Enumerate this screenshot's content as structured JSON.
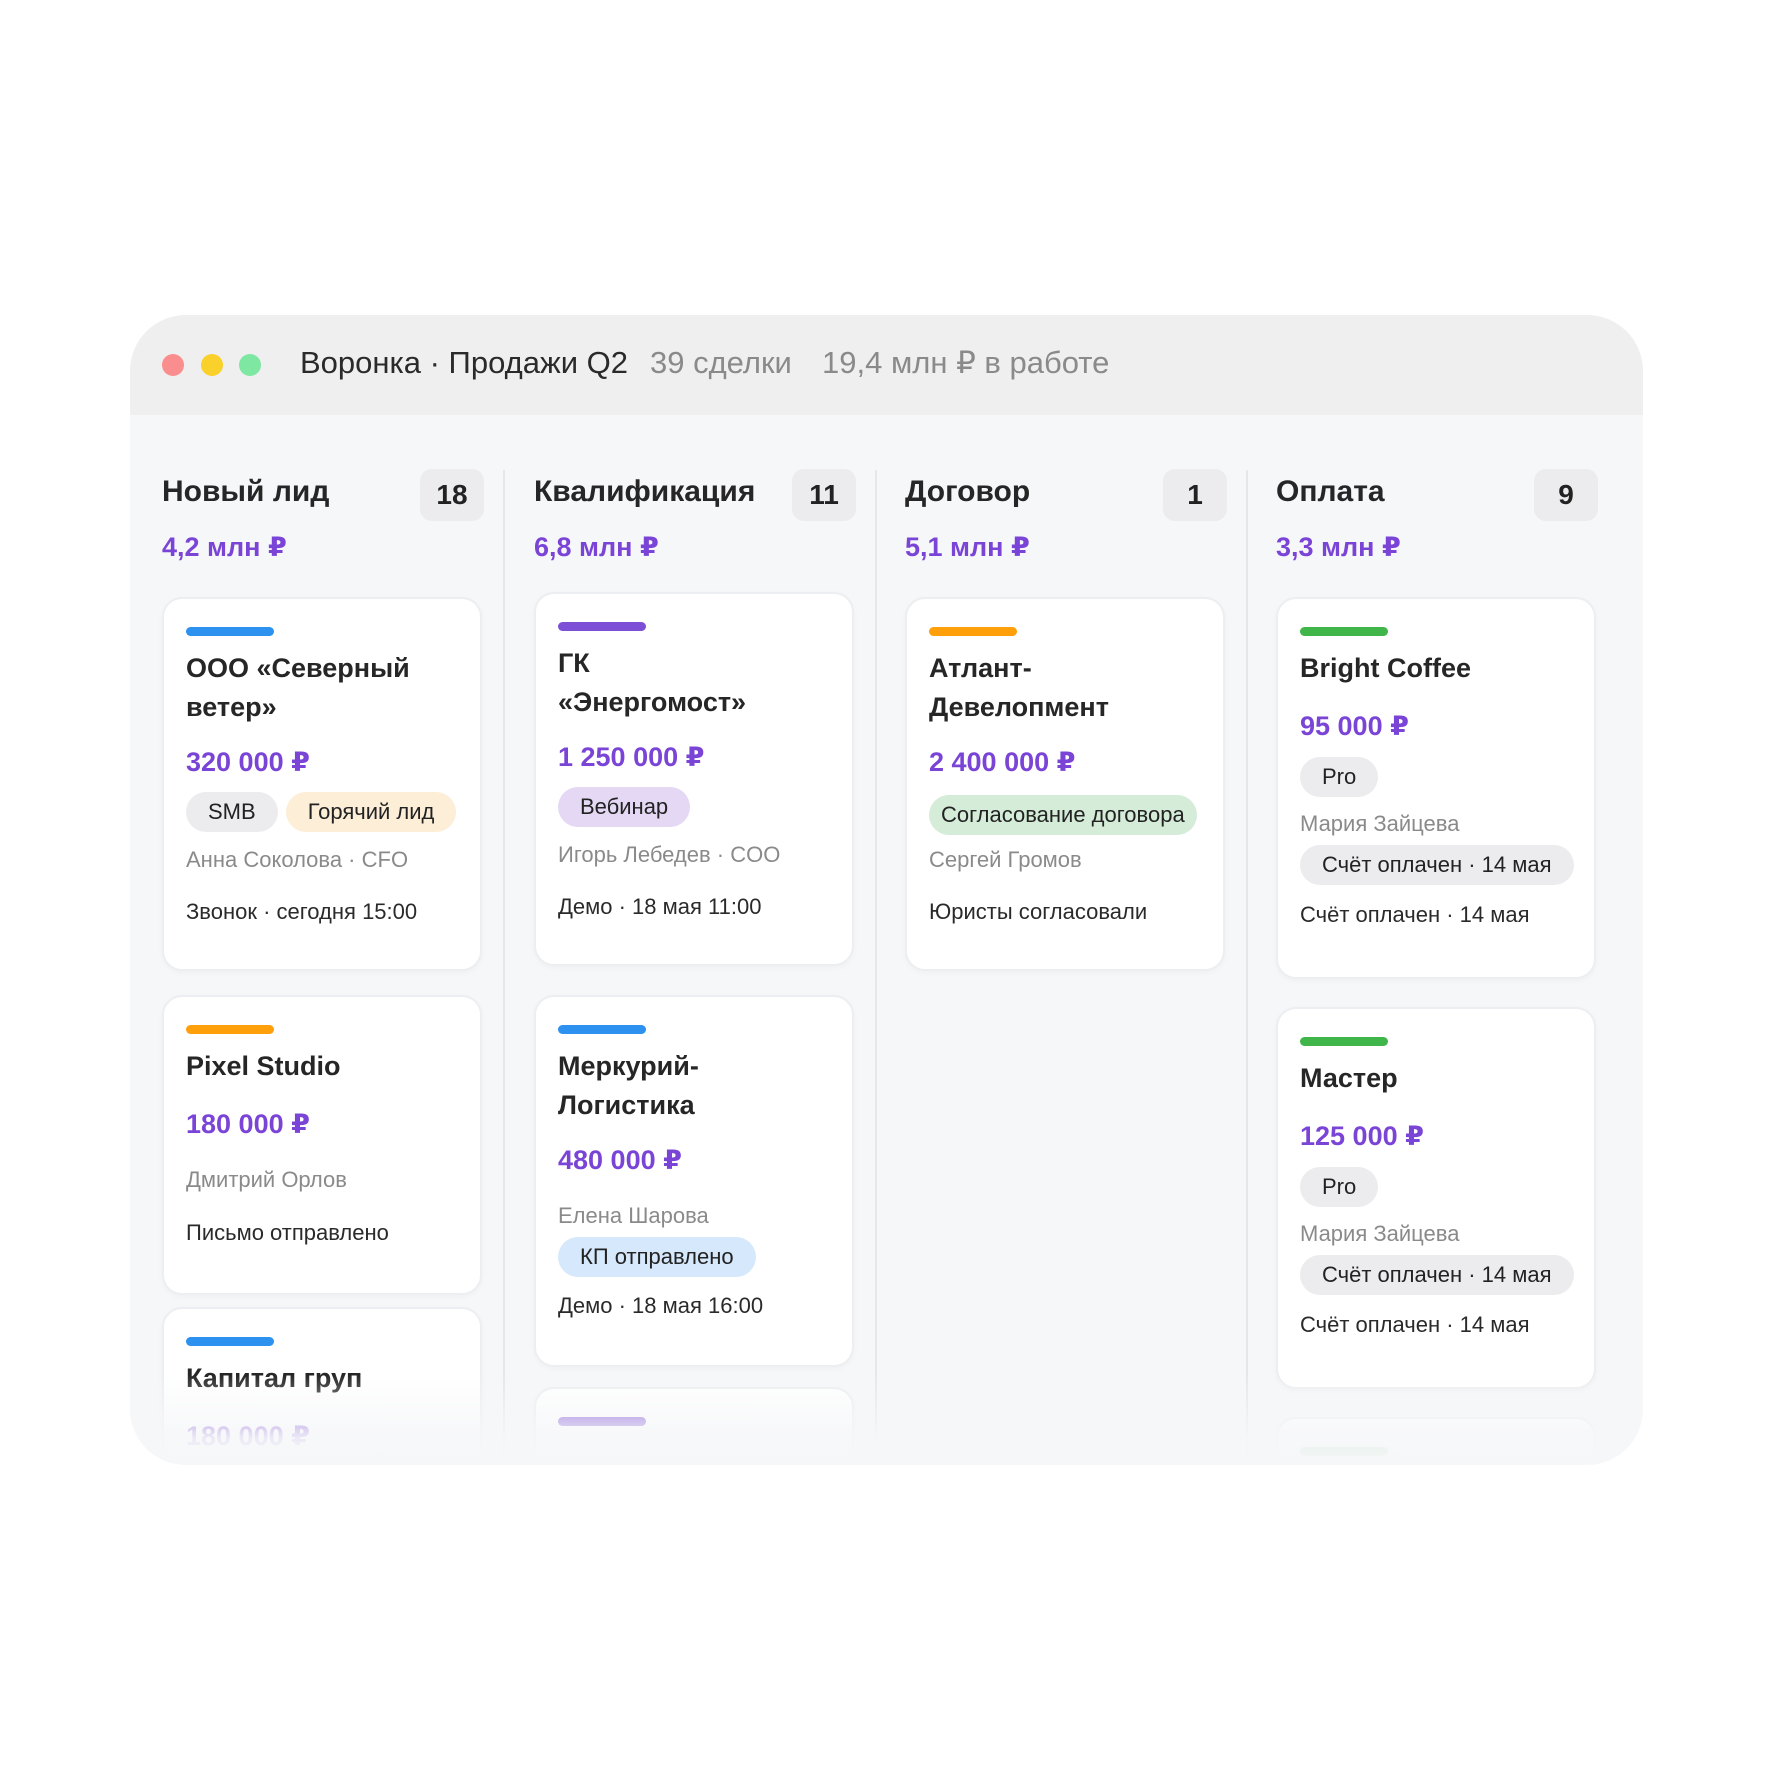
{
  "window": {
    "title": "Воронка · Продажи Q2",
    "deals": "39 сделки",
    "in_work": "19,4 млн ₽ в работе",
    "dots": [
      "#fa8e8e",
      "#fad02a",
      "#7ee7a1"
    ]
  },
  "colors": {
    "accent": "#7a44d6",
    "blue": "#2d91f0",
    "purple": "#7c4fd6",
    "orange": "#ff9f0a",
    "green": "#40b54a",
    "tag_neutral_bg": "#ececee",
    "tag_hot_bg": "#fdeed8",
    "tag_webinar_bg": "#e4d8f5",
    "tag_contract_bg": "#d4ecd8",
    "tag_kp_bg": "#d6e8fb"
  },
  "columns": [
    {
      "title": "Новый лид",
      "count": "18",
      "sum": "4,2 млн ₽",
      "cards": [
        {
          "bar": "blue",
          "name_1": "ООО «Северный",
          "name_2": "ветер»",
          "amount": "320 000 ₽",
          "tags": [
            "SMB",
            "Горячий лид"
          ],
          "contact": "Анна Соколова · CFO",
          "next": "Звонок · сегодня 15:00"
        },
        {
          "bar": "orange",
          "name_1": "Pixel Studio",
          "amount": "180 000 ₽",
          "contact": "Дмитрий Орлов",
          "next": "Письмо отправлено"
        },
        {
          "bar": "blue",
          "name_1": "Капитал груп",
          "amount": "180 000 ₽"
        }
      ]
    },
    {
      "title": "Квалификация",
      "count": "11",
      "sum": "6,8 млн ₽",
      "cards": [
        {
          "bar": "purple",
          "name_1": "ГК",
          "name_2": "«Энергомост»",
          "amount": "1 250 000 ₽",
          "tags": [
            "Вебинар"
          ],
          "contact": "Игорь Лебедев · COO",
          "next": "Демо · 18 мая 11:00"
        },
        {
          "bar": "blue",
          "name_1": "Меркурий-",
          "name_2": "Логистика",
          "amount": "480 000 ₽",
          "contact": "Елена Шарова",
          "tags": [
            "КП отправлено"
          ],
          "next": "Демо · 18 мая 16:00"
        },
        {
          "bar": "purple"
        }
      ]
    },
    {
      "title": "Договор",
      "count": "1",
      "sum": "5,1 млн ₽",
      "cards": [
        {
          "bar": "orange",
          "name_1": "Атлант-",
          "name_2": "Девелопмент",
          "amount": "2 400 000 ₽",
          "tags": [
            "Согласование договора"
          ],
          "contact": "Сергей Громов",
          "next": "Юристы согласовали"
        }
      ]
    },
    {
      "title": "Оплата",
      "count": "9",
      "sum": "3,3 млн ₽",
      "cards": [
        {
          "bar": "green",
          "name_1": "Bright Coffee",
          "amount": "95 000 ₽",
          "tags": [
            "Pro"
          ],
          "contact": "Мария Зайцева",
          "status": "Счёт оплачен · 14 мая",
          "next": "Счёт оплачен · 14 мая"
        },
        {
          "bar": "green",
          "name_1": "Мастер",
          "amount": "125 000 ₽",
          "tags": [
            "Pro"
          ],
          "contact": "Мария Зайцева",
          "status": "Счёт оплачен · 14 мая",
          "next": "Счёт оплачен · 14 мая"
        },
        {
          "bar": "green"
        }
      ]
    }
  ]
}
